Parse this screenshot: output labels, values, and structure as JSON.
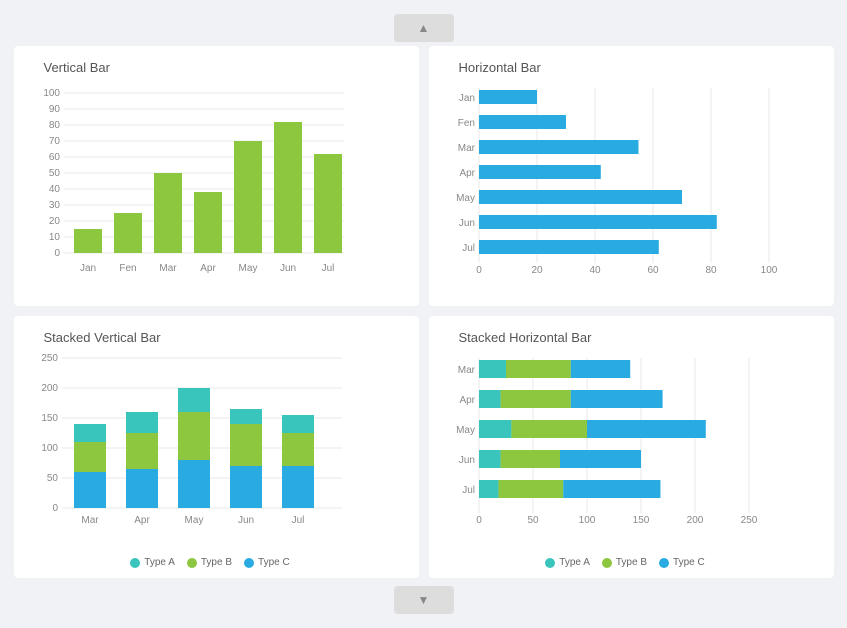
{
  "nav": {
    "up_label": "▲",
    "down_label": "▼"
  },
  "charts": {
    "vertical_bar": {
      "title": "Vertical Bar",
      "months": [
        "Jan",
        "Fen",
        "Mar",
        "Apr",
        "May",
        "Jun",
        "Jul"
      ],
      "values": [
        15,
        25,
        50,
        38,
        70,
        82,
        62
      ],
      "y_max": 100,
      "y_ticks": [
        0,
        10,
        20,
        30,
        40,
        50,
        60,
        70,
        80,
        90,
        100
      ]
    },
    "horizontal_bar": {
      "title": "Horizontal Bar",
      "months": [
        "Jan",
        "Fen",
        "Mar",
        "Apr",
        "May",
        "Jun",
        "Jul"
      ],
      "values": [
        20,
        30,
        55,
        42,
        70,
        82,
        62
      ],
      "x_max": 100,
      "x_ticks": [
        0,
        20,
        40,
        60,
        80,
        100
      ]
    },
    "stacked_vertical": {
      "title": "Stacked Vertical Bar",
      "months": [
        "Mar",
        "Apr",
        "May",
        "Jun",
        "Jul"
      ],
      "typeA": [
        30,
        35,
        40,
        25,
        30
      ],
      "typeB": [
        50,
        60,
        80,
        70,
        55
      ],
      "typeC": [
        60,
        65,
        80,
        60,
        70
      ],
      "y_max": 250,
      "y_ticks": [
        0,
        50,
        100,
        150,
        200,
        250
      ],
      "legend": [
        "Type A",
        "Type B",
        "Type C"
      ],
      "colors": [
        "#39C5BB",
        "#8DC63F",
        "#29ABE2"
      ]
    },
    "stacked_horizontal": {
      "title": "Stacked Horizontal Bar",
      "months": [
        "Mar",
        "Apr",
        "May",
        "Jun",
        "Jul"
      ],
      "typeA": [
        25,
        20,
        30,
        20,
        18
      ],
      "typeB": [
        60,
        65,
        70,
        55,
        60
      ],
      "typeC": [
        55,
        85,
        110,
        75,
        90
      ],
      "x_max": 250,
      "x_ticks": [
        0,
        50,
        100,
        150,
        200,
        250
      ],
      "legend": [
        "Type A",
        "Type B",
        "Type C"
      ],
      "colors": [
        "#39C5BB",
        "#8DC63F",
        "#29ABE2"
      ]
    }
  }
}
